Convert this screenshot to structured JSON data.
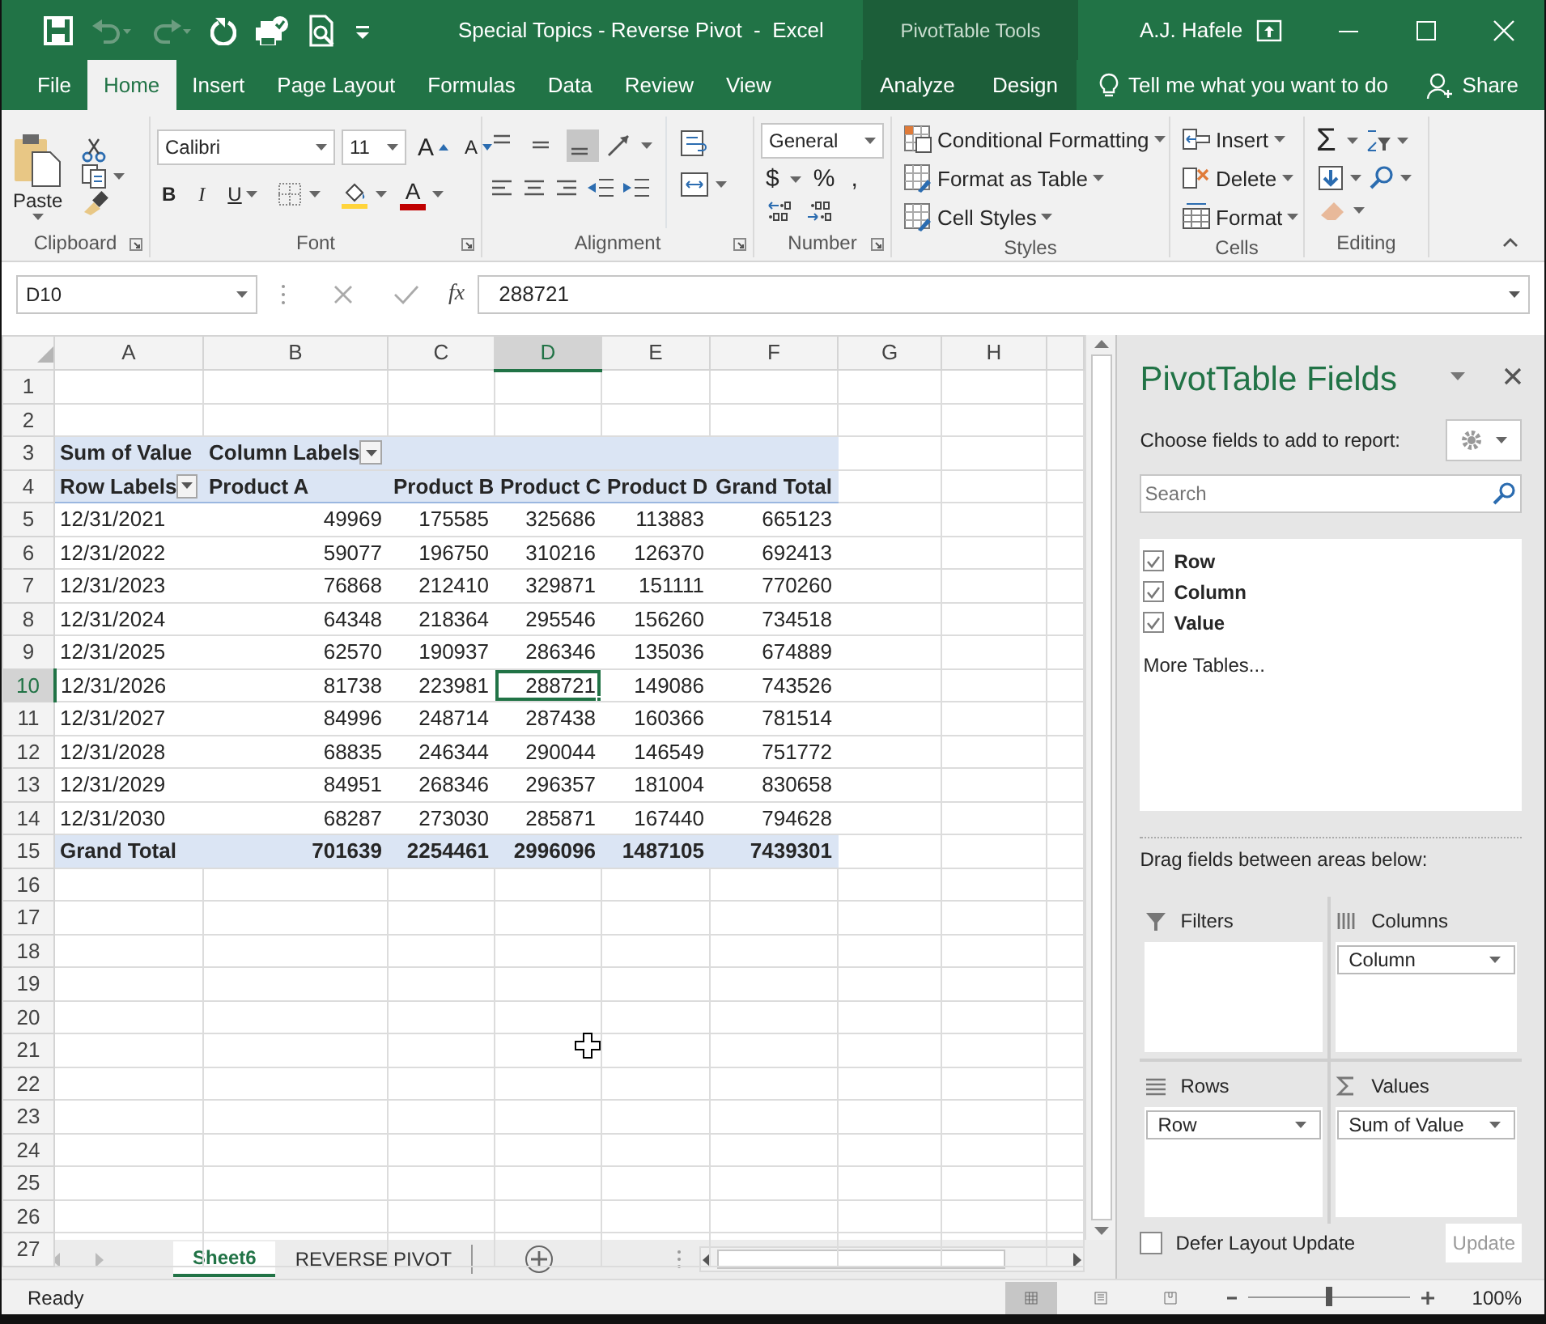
{
  "title_bar": {
    "title": "Special Topics - Reverse Pivot  -  Excel",
    "context_label": "PivotTable Tools",
    "user": "A.J. Hafele",
    "quick_access": [
      {
        "kind": "save",
        "disabled": false
      },
      {
        "kind": "undo",
        "disabled": true
      },
      {
        "kind": "redo",
        "disabled": true
      },
      {
        "kind": "refresh",
        "disabled": false
      },
      {
        "kind": "touch",
        "disabled": false
      },
      {
        "kind": "preview",
        "disabled": false
      },
      {
        "kind": "customize",
        "disabled": false
      }
    ]
  },
  "ribbon_tabs": [
    {
      "label": "File",
      "selected": false,
      "contextual": false
    },
    {
      "label": "Home",
      "selected": true,
      "contextual": false
    },
    {
      "label": "Insert",
      "selected": false,
      "contextual": false
    },
    {
      "label": "Page Layout",
      "selected": false,
      "contextual": false
    },
    {
      "label": "Formulas",
      "selected": false,
      "contextual": false
    },
    {
      "label": "Data",
      "selected": false,
      "contextual": false
    },
    {
      "label": "Review",
      "selected": false,
      "contextual": false
    },
    {
      "label": "View",
      "selected": false,
      "contextual": false
    },
    {
      "label": "Analyze",
      "selected": false,
      "contextual": true
    },
    {
      "label": "Design",
      "selected": false,
      "contextual": true
    }
  ],
  "tell_me": "Tell me what you want to do",
  "share": "Share",
  "ribbon": {
    "clipboard": {
      "label": "Clipboard",
      "paste": "Paste"
    },
    "font": {
      "label": "Font",
      "name": "Calibri",
      "size": "11",
      "grow": "A",
      "shrink": "A",
      "bold": "B",
      "italic": "I",
      "underline": "U",
      "font_color": "A"
    },
    "alignment": {
      "label": "Alignment",
      "vertical": [
        {
          "kind": "top",
          "selected": false
        },
        {
          "kind": "middle",
          "selected": false
        },
        {
          "kind": "bottom",
          "selected": true
        }
      ]
    },
    "number": {
      "label": "Number",
      "format": "General",
      "symbols": [
        "$",
        "%",
        ","
      ]
    },
    "styles": {
      "label": "Styles",
      "buttons": [
        "Conditional Formatting",
        "Format as Table",
        "Cell Styles"
      ]
    },
    "cells": {
      "label": "Cells",
      "buttons": [
        "Insert",
        "Delete",
        "Format"
      ]
    },
    "editing": {
      "label": "Editing",
      "sum": "Σ"
    }
  },
  "formula_bar": {
    "name_box": "D10",
    "function_label": "fx",
    "formula": "288721"
  },
  "sheet": {
    "columns": [
      {
        "label": "A",
        "selected": false
      },
      {
        "label": "B",
        "selected": false
      },
      {
        "label": "C",
        "selected": false
      },
      {
        "label": "D",
        "selected": true
      },
      {
        "label": "E",
        "selected": false
      },
      {
        "label": "F",
        "selected": false
      },
      {
        "label": "G",
        "selected": false
      },
      {
        "label": "H",
        "selected": false
      }
    ],
    "rows": [
      {
        "label": "1",
        "selected": false,
        "kind": "blank"
      },
      {
        "label": "2",
        "selected": false,
        "kind": "blank"
      },
      {
        "label": "3",
        "selected": false,
        "kind": "header",
        "cells": [
          {
            "text": "Sum of Value",
            "filter": false
          },
          {
            "text": "Column Labels",
            "filter": true
          }
        ]
      },
      {
        "label": "4",
        "selected": false,
        "kind": "header",
        "cells": [
          {
            "text": "Row Labels",
            "filter": true
          },
          {
            "text": "Product A",
            "filter": false
          },
          {
            "text": "Product B",
            "filter": false
          },
          {
            "text": "Product C",
            "filter": false
          },
          {
            "text": "Product D",
            "filter": false
          },
          {
            "text": "Grand Total",
            "filter": false
          }
        ]
      },
      {
        "label": "5",
        "selected": false,
        "kind": "data",
        "cells": [
          "12/31/2021",
          "49969",
          "175585",
          "325686",
          "113883",
          "665123"
        ]
      },
      {
        "label": "6",
        "selected": false,
        "kind": "data",
        "cells": [
          "12/31/2022",
          "59077",
          "196750",
          "310216",
          "126370",
          "692413"
        ]
      },
      {
        "label": "7",
        "selected": false,
        "kind": "data",
        "cells": [
          "12/31/2023",
          "76868",
          "212410",
          "329871",
          "151111",
          "770260"
        ]
      },
      {
        "label": "8",
        "selected": false,
        "kind": "data",
        "cells": [
          "12/31/2024",
          "64348",
          "218364",
          "295546",
          "156260",
          "734518"
        ]
      },
      {
        "label": "9",
        "selected": false,
        "kind": "data",
        "cells": [
          "12/31/2025",
          "62570",
          "190937",
          "286346",
          "135036",
          "674889"
        ]
      },
      {
        "label": "10",
        "selected": true,
        "kind": "data",
        "cells": [
          "12/31/2026",
          "81738",
          "223981",
          "288721",
          "149086",
          "743526"
        ]
      },
      {
        "label": "11",
        "selected": false,
        "kind": "data",
        "cells": [
          "12/31/2027",
          "84996",
          "248714",
          "287438",
          "160366",
          "781514"
        ]
      },
      {
        "label": "12",
        "selected": false,
        "kind": "data",
        "cells": [
          "12/31/2028",
          "68835",
          "246344",
          "290044",
          "146549",
          "751772"
        ]
      },
      {
        "label": "13",
        "selected": false,
        "kind": "data",
        "cells": [
          "12/31/2029",
          "84951",
          "268346",
          "296357",
          "181004",
          "830658"
        ]
      },
      {
        "label": "14",
        "selected": false,
        "kind": "data",
        "cells": [
          "12/31/2030",
          "68287",
          "273030",
          "285871",
          "167440",
          "794628"
        ]
      },
      {
        "label": "15",
        "selected": false,
        "kind": "total",
        "cells": [
          "Grand Total",
          "701639",
          "2254461",
          "2996096",
          "1487105",
          "7439301"
        ]
      },
      {
        "label": "16",
        "selected": false,
        "kind": "blank"
      },
      {
        "label": "17",
        "selected": false,
        "kind": "blank"
      },
      {
        "label": "18",
        "selected": false,
        "kind": "blank"
      },
      {
        "label": "19",
        "selected": false,
        "kind": "blank"
      },
      {
        "label": "20",
        "selected": false,
        "kind": "blank"
      },
      {
        "label": "21",
        "selected": false,
        "kind": "blank"
      },
      {
        "label": "22",
        "selected": false,
        "kind": "blank"
      },
      {
        "label": "23",
        "selected": false,
        "kind": "blank"
      },
      {
        "label": "24",
        "selected": false,
        "kind": "blank"
      },
      {
        "label": "25",
        "selected": false,
        "kind": "blank"
      },
      {
        "label": "26",
        "selected": false,
        "kind": "blank"
      },
      {
        "label": "27",
        "selected": false,
        "kind": "blank"
      }
    ]
  },
  "pivot_panel": {
    "title": "PivotTable Fields",
    "subtitle": "Choose fields to add to report:",
    "search_placeholder": "Search",
    "fields": [
      {
        "label": "Row",
        "checked": true
      },
      {
        "label": "Column",
        "checked": true
      },
      {
        "label": "Value",
        "checked": true
      }
    ],
    "more_tables": "More Tables...",
    "drag_hint": "Drag fields between areas below:",
    "areas": [
      {
        "kind": "filters",
        "title": "Filters"
      },
      {
        "kind": "columns",
        "title": "Columns",
        "items": [
          "Column"
        ]
      },
      {
        "kind": "rows",
        "title": "Rows",
        "items": [
          "Row"
        ]
      },
      {
        "kind": "values",
        "title": "Values",
        "items": [
          "Sum of Value"
        ]
      }
    ],
    "defer": {
      "label": "Defer Layout Update",
      "checked": false
    },
    "update": {
      "label": "Update",
      "disabled": true
    }
  },
  "sheet_tabs": [
    {
      "label": "Sheet6",
      "selected": true
    },
    {
      "label": "REVERSE PIVOT",
      "selected": false
    }
  ],
  "status_bar": {
    "status": "Ready",
    "views": [
      {
        "kind": "normal",
        "selected": true
      },
      {
        "kind": "page_layout",
        "selected": false
      },
      {
        "kind": "page_break",
        "selected": false
      }
    ],
    "zoom": {
      "level": 0.5,
      "label": "100%"
    }
  }
}
